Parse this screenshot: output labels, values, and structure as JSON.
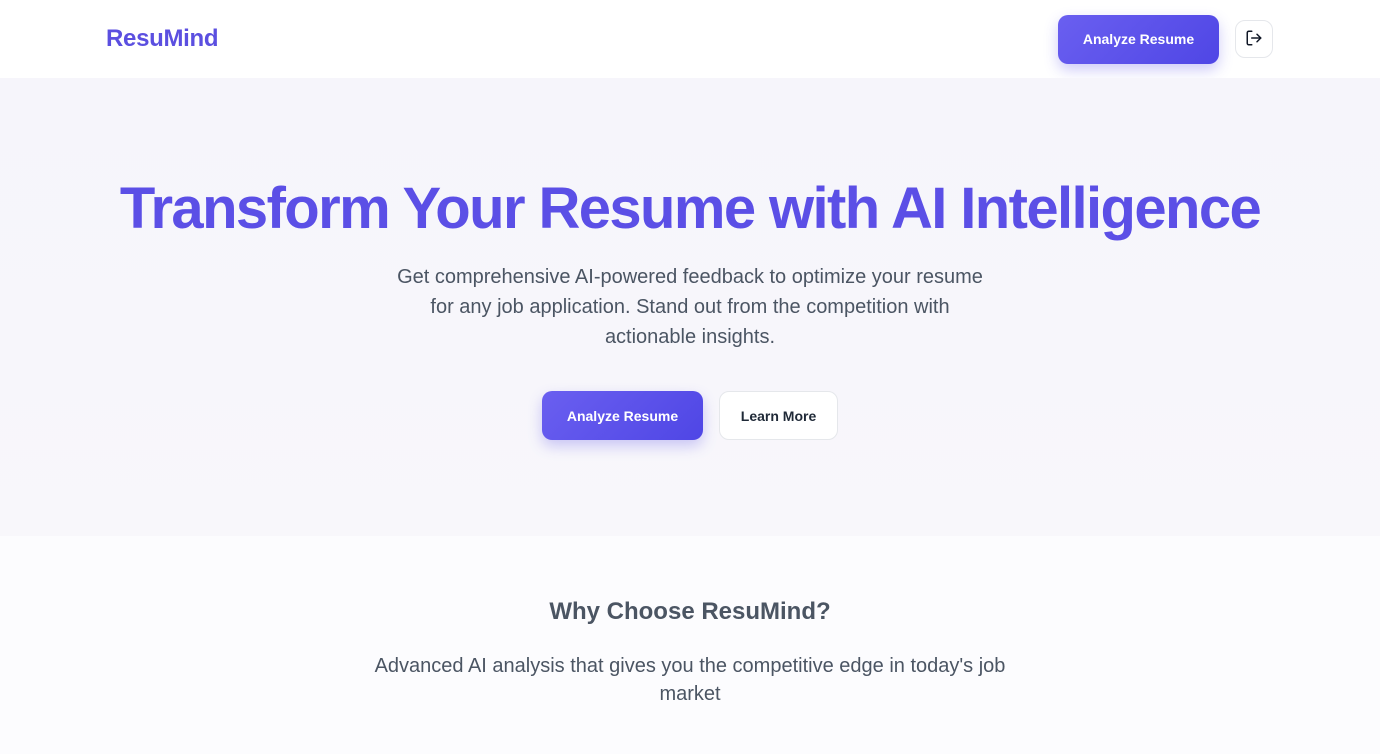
{
  "header": {
    "logo": "ResuMind",
    "analyze_label": "Analyze Resume",
    "logout_icon": "logout-icon"
  },
  "hero": {
    "title": "Transform Your Resume with AI Intelligence",
    "subtitle": "Get comprehensive AI-powered feedback to optimize your resume for any job application. Stand out from the competition with actionable insights.",
    "primary_label": "Analyze Resume",
    "secondary_label": "Learn More"
  },
  "features": {
    "title": "Why Choose ResuMind?",
    "subtitle": "Advanced AI analysis that gives you the competitive edge in today's job market"
  },
  "colors": {
    "brand": "#5b4fe0",
    "primary_gradient_start": "#6a5ff0",
    "primary_gradient_end": "#4f46e5",
    "hero_background": "#f6f5fb"
  }
}
